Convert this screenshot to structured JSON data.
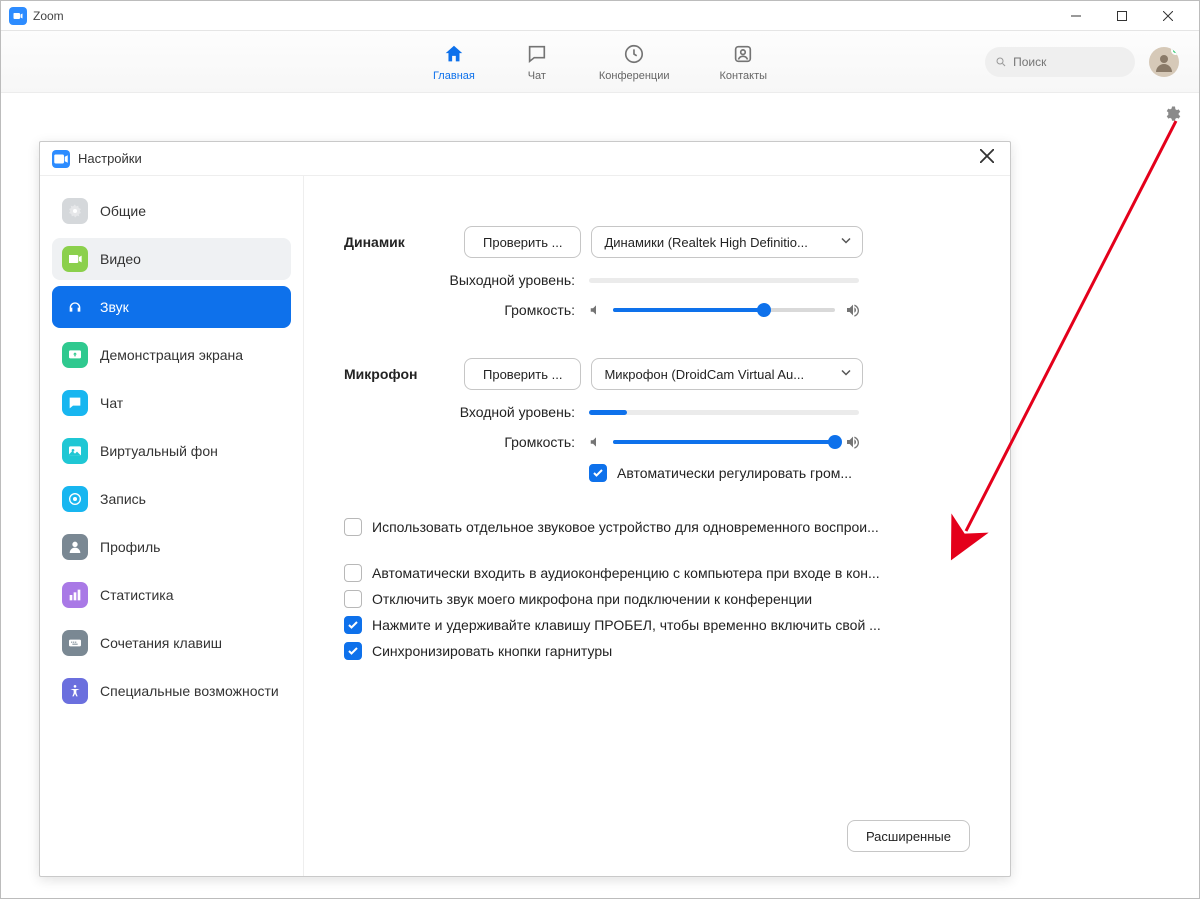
{
  "app_title": "Zoom",
  "nav": [
    {
      "label": "Главная",
      "icon": "home",
      "active": true
    },
    {
      "label": "Чат",
      "icon": "chat",
      "active": false
    },
    {
      "label": "Конференции",
      "icon": "clock",
      "active": false
    },
    {
      "label": "Контакты",
      "icon": "contact",
      "active": false
    }
  ],
  "search_placeholder": "Поиск",
  "settings_title": "Настройки",
  "sidebar": [
    {
      "label": "Общие",
      "icon": "gear",
      "color": "#d5d8db"
    },
    {
      "label": "Видео",
      "icon": "video",
      "color": "#8bd04c",
      "highlight": true
    },
    {
      "label": "Звук",
      "icon": "headphones",
      "color": "#0e71eb",
      "active": true
    },
    {
      "label": "Демонстрация экрана",
      "icon": "share",
      "color": "#2fc98f"
    },
    {
      "label": "Чат",
      "icon": "chat2",
      "color": "#18b6f0"
    },
    {
      "label": "Виртуальный фон",
      "icon": "vbg",
      "color": "#1fc7d4"
    },
    {
      "label": "Запись",
      "icon": "record",
      "color": "#18b6f0"
    },
    {
      "label": "Профиль",
      "icon": "profile",
      "color": "#7a8893"
    },
    {
      "label": "Статистика",
      "icon": "stats",
      "color": "#a979e6"
    },
    {
      "label": "Сочетания клавиш",
      "icon": "keyboard",
      "color": "#7a8893"
    },
    {
      "label": "Специальные возможности",
      "icon": "access",
      "color": "#6b6fde"
    }
  ],
  "speaker": {
    "label": "Динамик",
    "test_button": "Проверить ...",
    "device": "Динамики (Realtek High Definitio...",
    "output_level_label": "Выходной уровень:",
    "output_level_pct": 0,
    "volume_label": "Громкость:",
    "volume_pct": 68
  },
  "mic": {
    "label": "Микрофон",
    "test_button": "Проверить ...",
    "device": "Микрофон (DroidCam Virtual Au...",
    "input_level_label": "Входной уровень:",
    "input_level_pct": 14,
    "volume_label": "Громкость:",
    "volume_pct": 100,
    "auto_adjust_label": "Автоматически регулировать гром...",
    "auto_adjust_checked": true
  },
  "options": [
    {
      "label": "Использовать отдельное звуковое устройство для одновременного воспрои...",
      "checked": false
    },
    {
      "label": "Автоматически входить в аудиоконференцию с компьютера при входе в кон...",
      "checked": false
    },
    {
      "label": "Отключить звук моего микрофона при подключении к конференции",
      "checked": false
    },
    {
      "label": "Нажмите и удерживайте клавишу ПРОБЕЛ, чтобы временно включить свой ...",
      "checked": true
    },
    {
      "label": "Синхронизировать кнопки гарнитуры",
      "checked": true
    }
  ],
  "advanced_button": "Расширенные"
}
